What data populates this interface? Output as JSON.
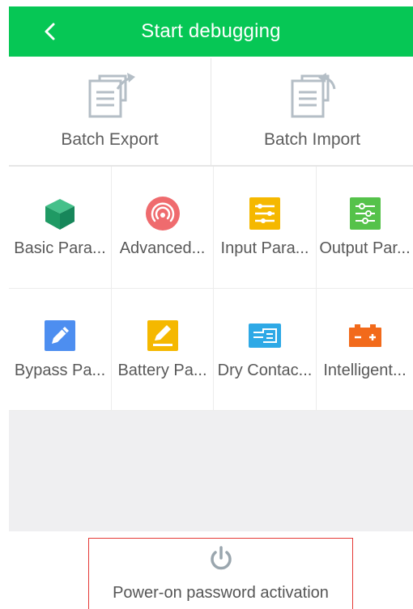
{
  "header": {
    "title": "Start debugging"
  },
  "batch": [
    {
      "label": "Batch Export"
    },
    {
      "label": "Batch Import"
    }
  ],
  "tiles": [
    {
      "label": "Basic Para...",
      "icon": "cube-icon",
      "color": "#1faa6f"
    },
    {
      "label": "Advanced...",
      "icon": "signal-icon",
      "color": "#ef6b6e"
    },
    {
      "label": "Input Para...",
      "icon": "input-sliders-icon",
      "color": "#f5b800"
    },
    {
      "label": "Output Par...",
      "icon": "output-sliders-icon",
      "color": "#55c24a"
    },
    {
      "label": "Bypass Pa...",
      "icon": "bypass-edit-icon",
      "color": "#4d8ef0"
    },
    {
      "label": "Battery Pa...",
      "icon": "battery-edit-icon",
      "color": "#f5b800"
    },
    {
      "label": "Dry Contac...",
      "icon": "dry-contact-icon",
      "color": "#2ea9e6"
    },
    {
      "label": "Intelligent...",
      "icon": "battery-icon",
      "color": "#f26a1b"
    }
  ],
  "power": {
    "label": "Power-on password activation"
  },
  "colors": {
    "header": "#06c755",
    "accent_border": "#e53935"
  }
}
